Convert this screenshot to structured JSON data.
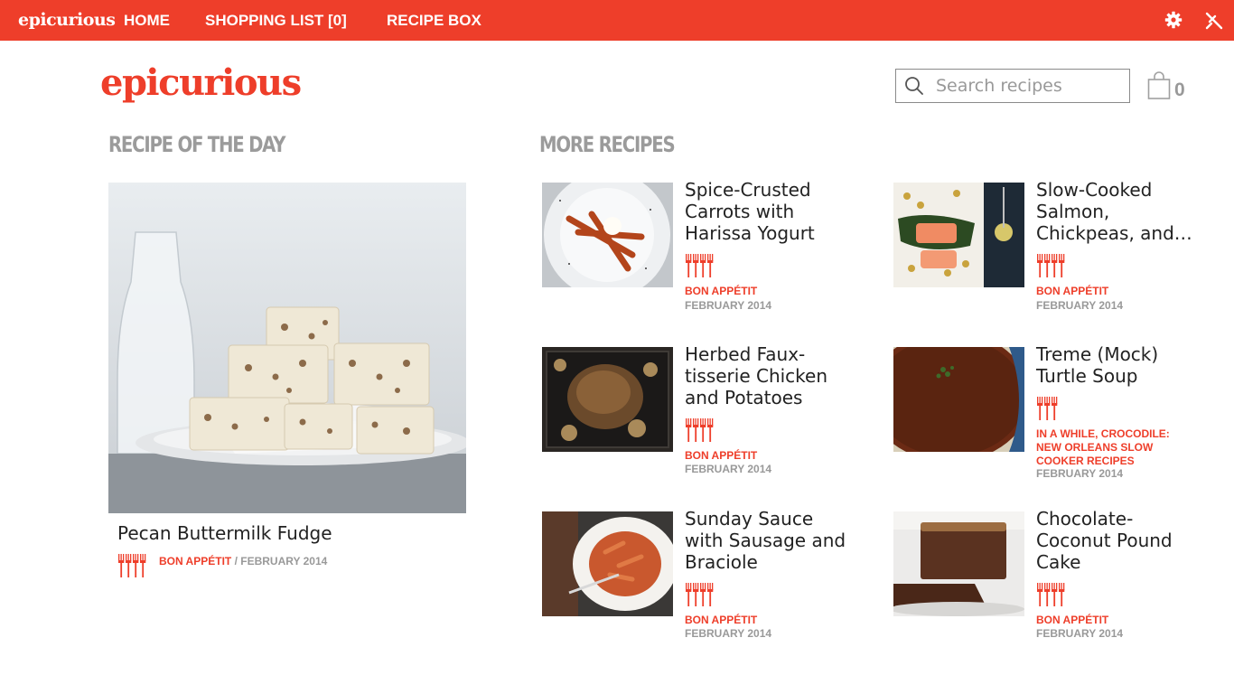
{
  "topbar": {
    "brand": "epicurious",
    "nav": [
      "HOME",
      "SHOPPING LIST [0]",
      "RECIPE BOX"
    ]
  },
  "header": {
    "logo": "epicurious",
    "search_placeholder": "Search recipes",
    "bag_count": "0"
  },
  "sections": {
    "recipe_of_day": "RECIPE OF THE DAY",
    "more_recipes": "MORE RECIPES"
  },
  "recipe_of_day": {
    "title": "Pecan Buttermilk Fudge",
    "rating_forks": 4,
    "source": "BON APPÉTIT",
    "separator": " / ",
    "date": "FEBRUARY 2014"
  },
  "more_recipes": [
    {
      "title": "Spice-Crusted Carrots with Harissa Yogurt",
      "rating_forks": 4,
      "source": "BON APPÉTIT",
      "date": "FEBRUARY 2014"
    },
    {
      "title": "Slow-Cooked Salmon, Chickpeas, and…",
      "rating_forks": 4,
      "source": "BON APPÉTIT",
      "date": "FEBRUARY 2014"
    },
    {
      "title": "Herbed Faux-tisserie Chicken and Potatoes",
      "rating_forks": 4,
      "source": "BON APPÉTIT",
      "date": "FEBRUARY 2014"
    },
    {
      "title": "Treme (Mock) Turtle Soup",
      "rating_forks": 3,
      "source": "IN A WHILE, CROCODILE: NEW ORLEANS SLOW COOKER RECIPES",
      "date": "FEBRUARY 2014"
    },
    {
      "title": "Sunday Sauce with Sausage and Braciole",
      "rating_forks": 4,
      "source": "BON APPÉTIT",
      "date": "FEBRUARY 2014"
    },
    {
      "title": "Chocolate-Coconut Pound Cake",
      "rating_forks": 4,
      "source": "BON APPÉTIT",
      "date": "FEBRUARY 2014"
    }
  ],
  "colors": {
    "accent": "#ee3e2a",
    "muted": "#999999"
  }
}
